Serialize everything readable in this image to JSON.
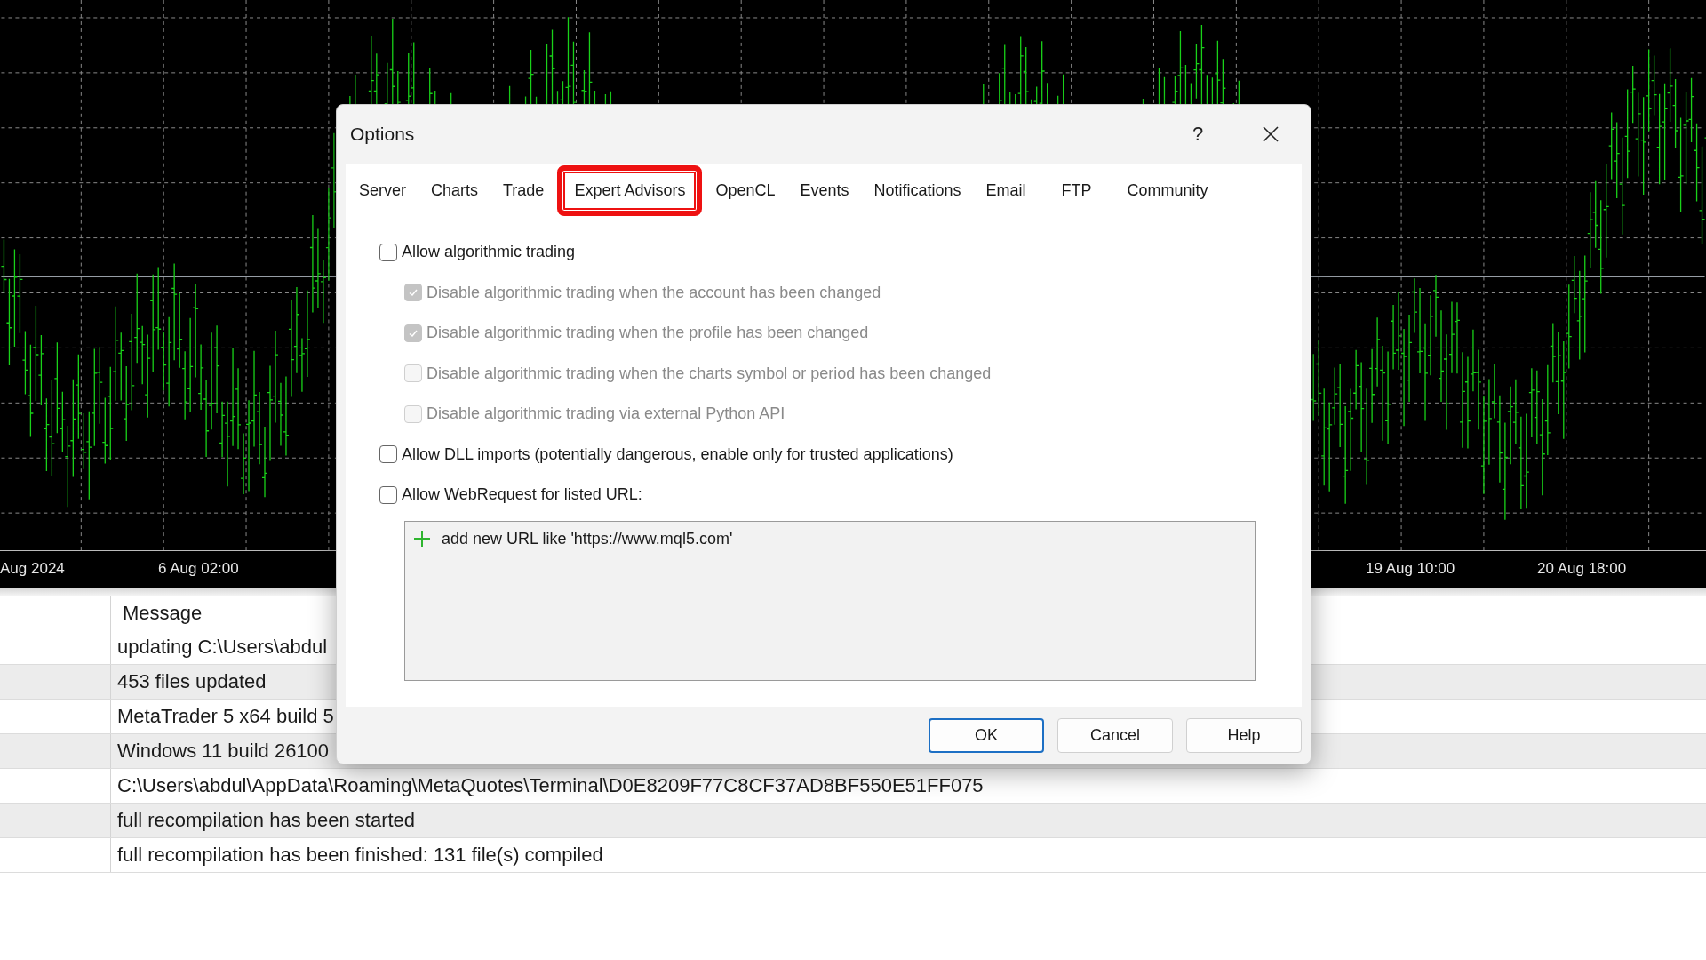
{
  "chart": {
    "time_labels": [
      "Aug 2024",
      "6 Aug 02:00",
      "19 Aug 10:00",
      "20 Aug 18:00"
    ]
  },
  "journal": {
    "columns": [
      "Message"
    ],
    "rows": [
      "updating C:\\Users\\abdul",
      "453 files updated",
      "MetaTrader 5 x64 build 5",
      "Windows 11 build 26100",
      "C:\\Users\\abdul\\AppData\\Roaming\\MetaQuotes\\Terminal\\D0E8209F77C8CF37AD8BF550E51FF075",
      "full recompilation has been started",
      "full recompilation has been finished:  131 file(s) compiled"
    ]
  },
  "dialog": {
    "title": "Options",
    "help": "?",
    "tabs": [
      {
        "label": "Server",
        "highlighted": false
      },
      {
        "label": "Charts",
        "highlighted": false
      },
      {
        "label": "Trade",
        "highlighted": false
      },
      {
        "label": "Expert Advisors",
        "highlighted": true
      },
      {
        "label": "OpenCL",
        "highlighted": false
      },
      {
        "label": "Events",
        "highlighted": false
      },
      {
        "label": "Notifications",
        "highlighted": false
      },
      {
        "label": "Email",
        "highlighted": false
      },
      {
        "label": "FTP",
        "highlighted": false
      },
      {
        "label": "Community",
        "highlighted": false
      }
    ],
    "options": [
      {
        "label": "Allow algorithmic trading",
        "checked": false,
        "disabled": false,
        "children": [
          {
            "label": "Disable algorithmic trading when the account has been changed",
            "checked": true,
            "disabled": true
          },
          {
            "label": "Disable algorithmic trading when the profile has been changed",
            "checked": true,
            "disabled": true
          },
          {
            "label": "Disable algorithmic trading when the charts symbol or period has been changed",
            "checked": false,
            "disabled": true
          },
          {
            "label": "Disable algorithmic trading via external Python API",
            "checked": false,
            "disabled": true
          }
        ]
      },
      {
        "label": "Allow DLL imports (potentially dangerous, enable only for trusted applications)",
        "checked": false,
        "disabled": false
      },
      {
        "label": "Allow WebRequest for listed URL:",
        "checked": false,
        "disabled": false
      }
    ],
    "url_list": {
      "add_item": "add new URL like 'https://www.mql5.com'"
    },
    "buttons": [
      {
        "label": "OK",
        "default": true
      },
      {
        "label": "Cancel",
        "default": false
      },
      {
        "label": "Help",
        "default": false
      }
    ]
  }
}
